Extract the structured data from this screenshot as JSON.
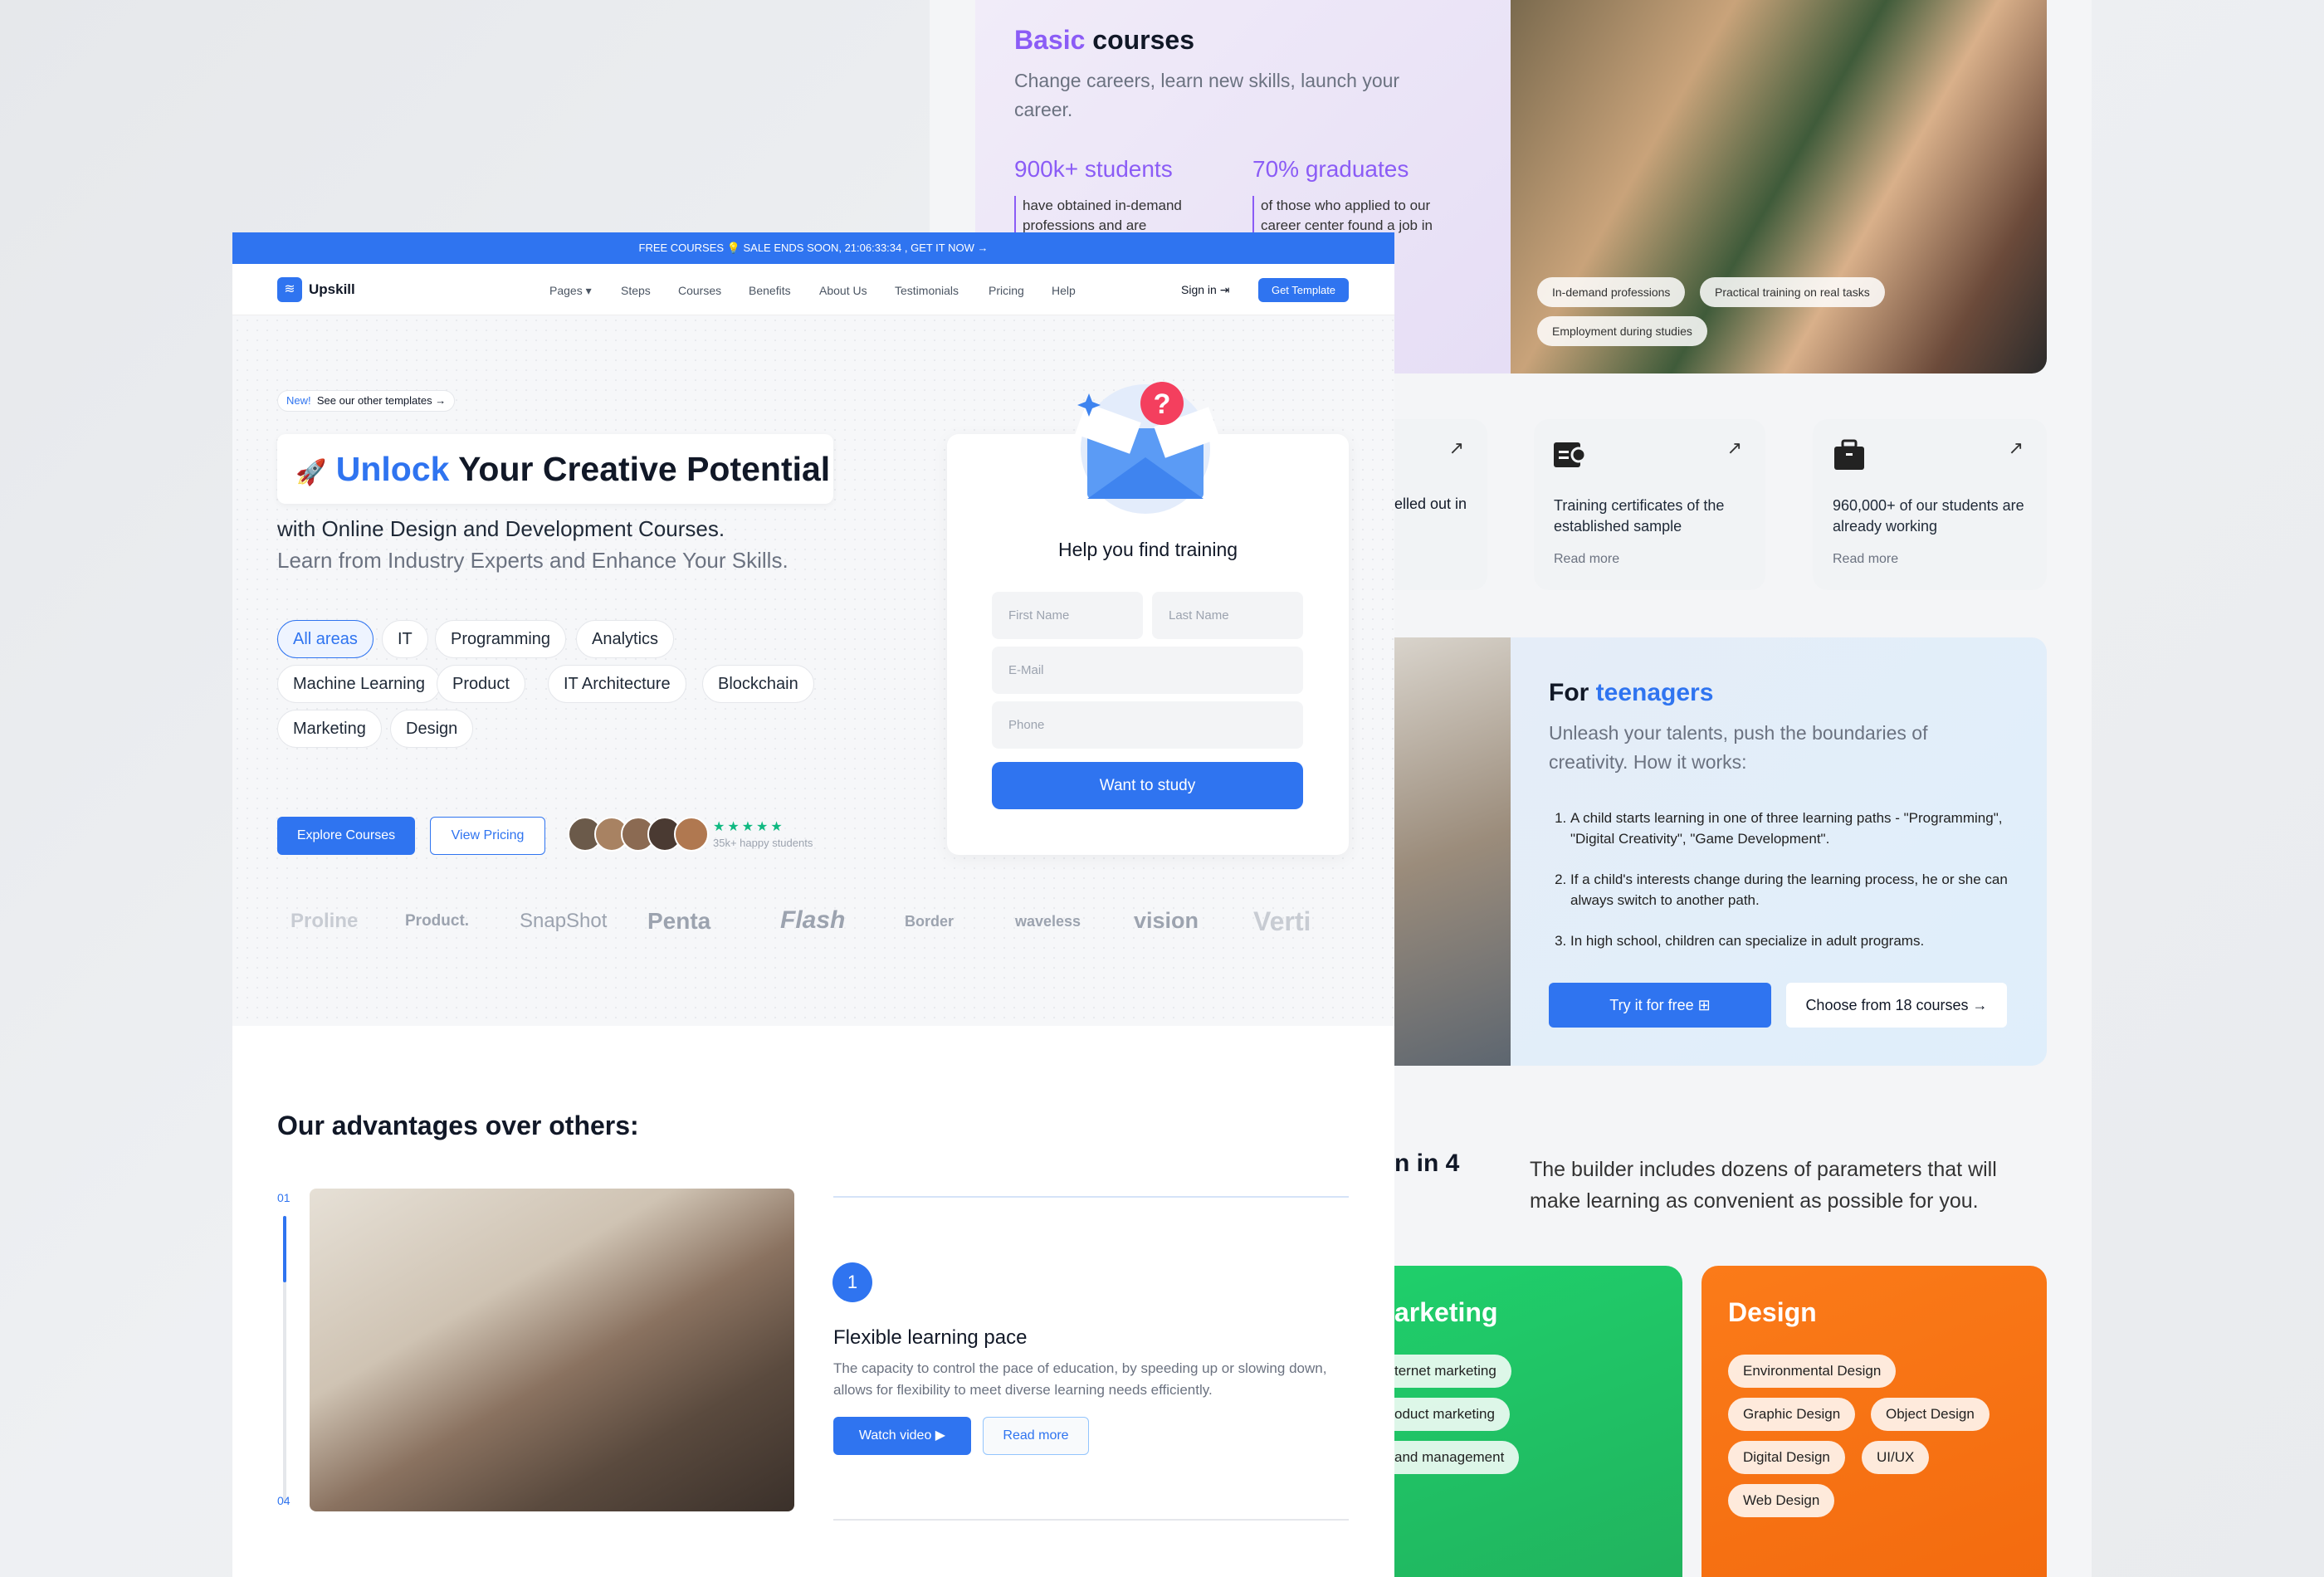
{
  "back": {
    "basic": {
      "title_accent": "Basic",
      "title_rest": " courses",
      "subtitle": "Change careers, learn new skills, launch your career.",
      "stats": [
        {
          "value": "900k+ students",
          "desc": "have obtained in-demand professions and are"
        },
        {
          "value": "70% graduates",
          "desc": "of those who applied to our career center found a job in"
        }
      ],
      "photo_tags": [
        "In-demand professions",
        "Practical training on real tasks",
        "Employment during studies"
      ]
    },
    "cards": [
      {
        "text": "elled out in",
        "read_more": ""
      },
      {
        "icon": "certificate-icon",
        "text": "Training certificates of the established sample",
        "read_more": "Read more"
      },
      {
        "icon": "briefcase-icon",
        "text": "960,000+ of our students are already working",
        "read_more": "Read more"
      }
    ],
    "teen": {
      "title_plain": "For ",
      "title_accent": "teenagers",
      "subtitle": "Unleash your talents, push the boundaries of creativity. How it works:",
      "steps": [
        "A child starts learning in one of three learning paths - \"Programming\", \"Digital Creativity\", \"Game Development\".",
        "If a child's interests change during the learning process, he or she can always switch to another path.",
        "In high school, children can specialize in adult programs."
      ],
      "try_label": "Try it for free",
      "choose_label": "Choose from 18 courses"
    },
    "builder": {
      "heading_fragment": "n in 4",
      "text": "The builder includes dozens of parameters that will make learning as convenient as possible for you."
    },
    "marketing": {
      "title": "arketing",
      "tags": [
        "ternet marketing",
        "oduct marketing",
        "and management"
      ]
    },
    "design": {
      "title": "Design",
      "tags": [
        "Environmental Design",
        "Graphic Design",
        "Object Design",
        "Digital Design",
        "UI/UX",
        "Web Design"
      ]
    }
  },
  "front": {
    "banner": "FREE COURSES 💡 SALE ENDS SOON, 21:06:33:34 , GET IT NOW →",
    "brand": "Upskill",
    "nav": [
      "Pages ▾",
      "Steps",
      "Courses",
      "Benefits",
      "About Us",
      "Testimonials",
      "Pricing",
      "Help"
    ],
    "sign_in": "Sign in",
    "get_template": "Get Template",
    "badge_new": "New!",
    "badge_text": "See our other templates",
    "title_accent": "Unlock",
    "title_rest": "Your Creative Potential",
    "sub1": "with Online Design and Development Courses.",
    "sub2": "Learn from Industry Experts and Enhance Your Skills.",
    "chips": [
      "All areas",
      "IT",
      "Programming",
      "Analytics",
      "Machine Learning",
      "Product",
      "IT Architecture",
      "Blockchain",
      "Marketing",
      "Design"
    ],
    "explore": "Explore Courses",
    "view_pricing": "View Pricing",
    "stars": "★★★★★",
    "happy": "35k+ happy students",
    "logos": [
      "Proline",
      "Product.",
      "SnapShot",
      "Penta",
      "Flash",
      "Border",
      "waveless",
      "vision",
      "Verti"
    ],
    "form": {
      "title": "Help you find training",
      "first": "First Name",
      "last": "Last Name",
      "email": "E-Mail",
      "phone": "Phone",
      "submit": "Want to study"
    },
    "adv": {
      "heading": "Our advantages over others:",
      "step_start": "01",
      "step_end": "04",
      "number": "1",
      "title": "Flexible learning pace",
      "desc": "The capacity to control the pace of education, by speeding up or slowing down, allows for flexibility to meet diverse learning needs efficiently.",
      "watch": "Watch video",
      "read": "Read more"
    }
  },
  "colors": {
    "brand": "#2f74f0",
    "purple": "#8b5cf6",
    "green": "#1fcf6b",
    "orange": "#f97316"
  }
}
